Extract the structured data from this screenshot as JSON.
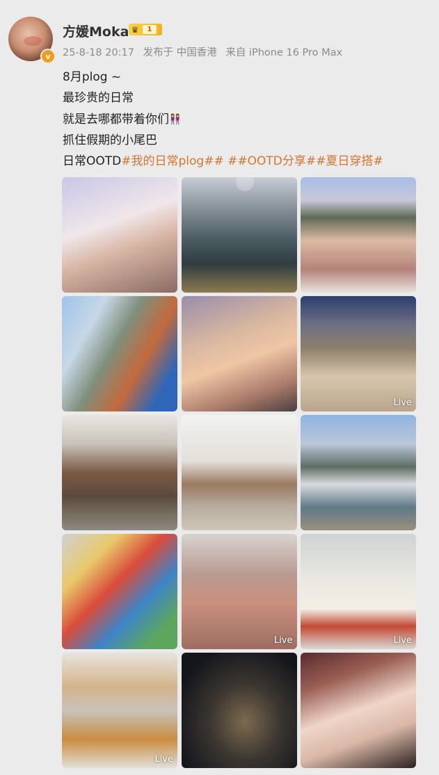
{
  "user": {
    "name": "方媛Moka",
    "vip_level": "1",
    "verified_mark": "v"
  },
  "meta": {
    "date": "25-8-18 20:17",
    "published_in": "发布于 中国香港",
    "device": "来自 iPhone 16 Pro Max"
  },
  "post": {
    "line1": "8月plog ~",
    "line2": "最珍贵的日常",
    "line3": "就是去哪都带着你们",
    "line4": "抓住假期的小尾巴",
    "line5_prefix": "日常OOTD",
    "tag1": "#我的日常plog#",
    "tag2": "# ##OOTD分享#",
    "tag3": "#夏日穿搭#"
  },
  "icons": {
    "crown": "crown-icon",
    "people_emoji": "people-holding-hands-emoji"
  },
  "photos": [
    {
      "name": "photo-1",
      "live": ""
    },
    {
      "name": "photo-2",
      "live": ""
    },
    {
      "name": "photo-3",
      "live": ""
    },
    {
      "name": "photo-4",
      "live": ""
    },
    {
      "name": "photo-5",
      "live": ""
    },
    {
      "name": "photo-6",
      "live": "Live"
    },
    {
      "name": "photo-7",
      "live": ""
    },
    {
      "name": "photo-8",
      "live": ""
    },
    {
      "name": "photo-9",
      "live": ""
    },
    {
      "name": "photo-10",
      "live": ""
    },
    {
      "name": "photo-11",
      "live": "Live"
    },
    {
      "name": "photo-12",
      "live": "Live"
    },
    {
      "name": "photo-13",
      "live": "Live"
    },
    {
      "name": "photo-14",
      "live": ""
    },
    {
      "name": "photo-15",
      "live": ""
    }
  ]
}
